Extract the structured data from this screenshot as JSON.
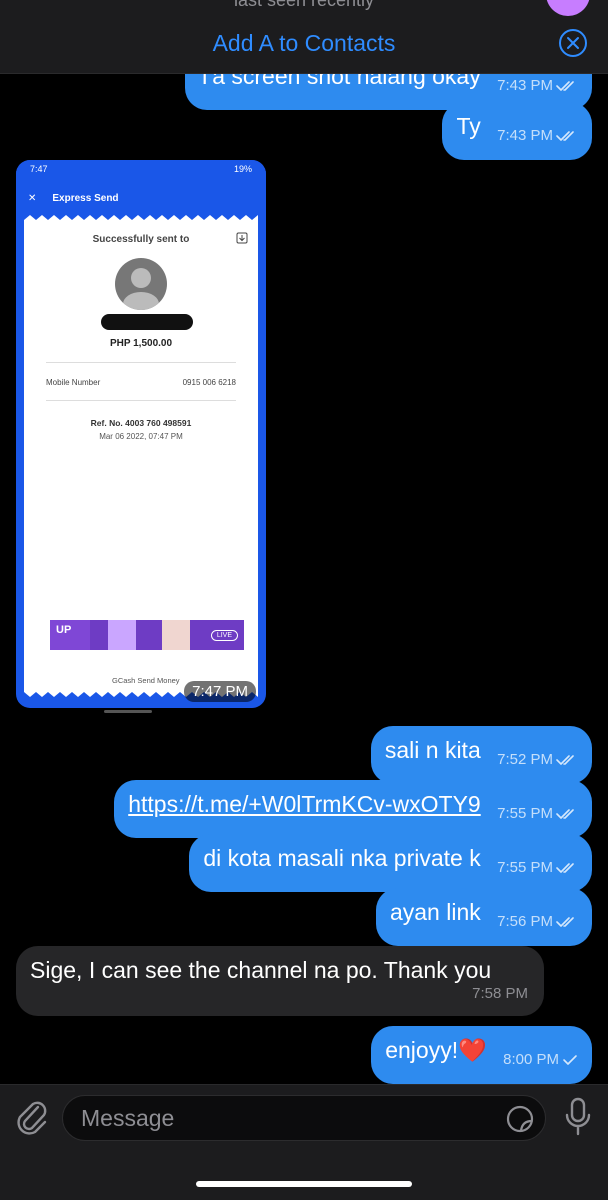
{
  "header": {
    "status": "last seen recently",
    "add_contact": "Add A to Contacts"
  },
  "screenshot": {
    "status_time": "7:47",
    "status_battery": "19%",
    "title": "Express Send",
    "success_text": "Successfully sent to",
    "amount": "PHP 1,500.00",
    "mobile_label": "Mobile Number",
    "mobile_value": "0915 006 6218",
    "ref": "Ref. No. 4003 760 498591",
    "date": "Mar 06 2022, 07:47 PM",
    "ad_logo": "UP",
    "ad_live": "LIVE",
    "footer": "GCash Send Money",
    "time": "7:47 PM"
  },
  "messages": [
    {
      "dir": "out",
      "text": "I'a screen shot nalang okay",
      "time": "7:43 PM",
      "status": "read"
    },
    {
      "dir": "out",
      "text": "Ty",
      "time": "7:43 PM",
      "status": "read"
    },
    {
      "dir": "out",
      "text": "sali n kita",
      "time": "7:52 PM",
      "status": "read"
    },
    {
      "dir": "out",
      "text": "https://t.me/+W0lTrmKCv-wxOTY9",
      "time": "7:55 PM",
      "status": "read",
      "link": true
    },
    {
      "dir": "out",
      "text": "di kota masali nka private k",
      "time": "7:55 PM",
      "status": "read"
    },
    {
      "dir": "out",
      "text": "ayan link",
      "time": "7:56 PM",
      "status": "read"
    },
    {
      "dir": "in",
      "text": "Sige, I can see the channel na po. Thank you",
      "time": "7:58 PM"
    },
    {
      "dir": "out",
      "text": "enjoyy!❤️",
      "time": "8:00 PM",
      "status": "sent"
    }
  ],
  "composer": {
    "placeholder": "Message"
  },
  "colors": {
    "outgoing_bubble": "#2e8bef",
    "incoming_bubble": "#262628",
    "accent": "#2f8cff",
    "gcash_blue": "#1a57e8"
  }
}
